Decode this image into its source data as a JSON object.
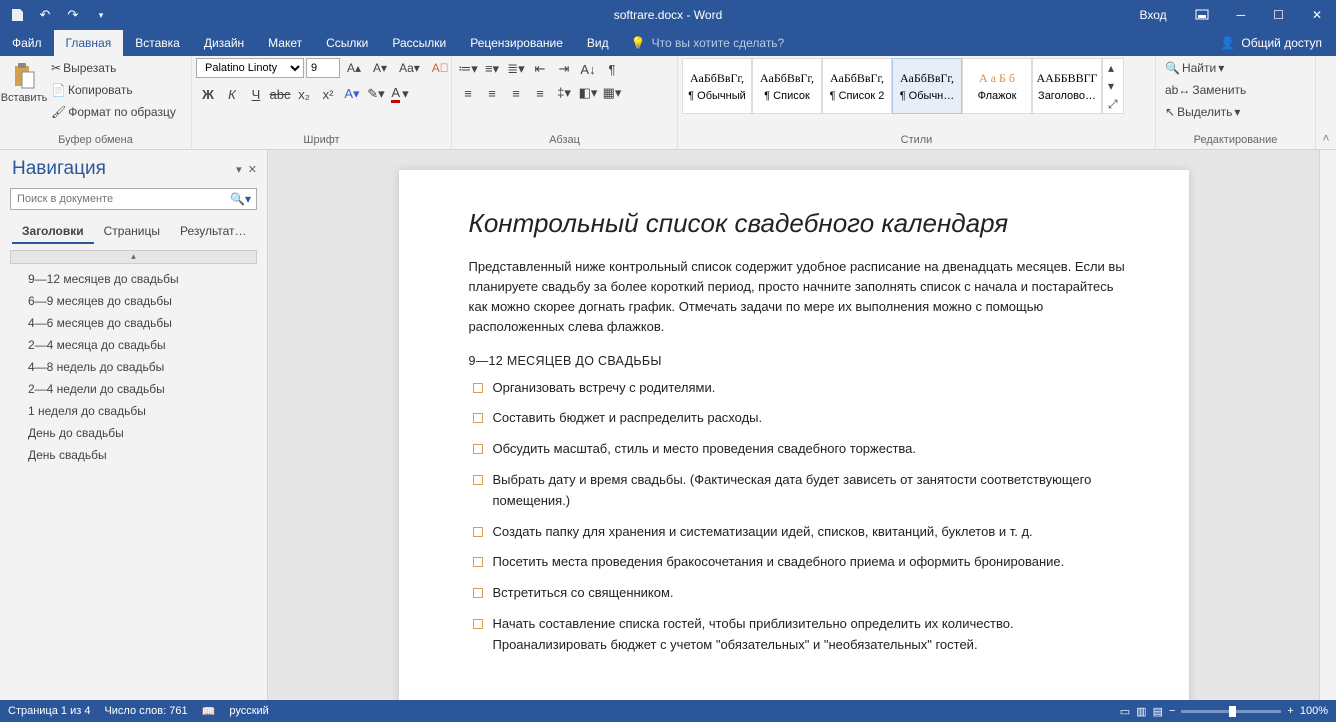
{
  "title": "softrare.docx - Word",
  "title_right": {
    "login": "Вход"
  },
  "menu": [
    "Файл",
    "Главная",
    "Вставка",
    "Дизайн",
    "Макет",
    "Ссылки",
    "Рассылки",
    "Рецензирование",
    "Вид"
  ],
  "tellme": "Что вы хотите сделать?",
  "share": "Общий доступ",
  "ribbon": {
    "clipboard": {
      "label": "Буфер обмена",
      "paste": "Вставить",
      "cut": "Вырезать",
      "copy": "Копировать",
      "format": "Формат по образцу"
    },
    "font": {
      "label": "Шрифт",
      "name": "Palatino Linoty",
      "size": "9"
    },
    "para": {
      "label": "Абзац"
    },
    "styles": {
      "label": "Стили",
      "items": [
        {
          "preview": "АаБбВвГг,",
          "name": "¶ Обычный"
        },
        {
          "preview": "АаБбВвГг,",
          "name": "¶ Список"
        },
        {
          "preview": "АаБбВвГг,",
          "name": "¶ Список 2"
        },
        {
          "preview": "АаБбВвГг,",
          "name": "¶ Обычн…"
        },
        {
          "preview": "А а Б б",
          "name": "Флажок",
          "color": "#e28c3f"
        },
        {
          "preview": "ААББВВГГ",
          "name": "Заголово…"
        }
      ]
    },
    "editing": {
      "label": "Редактирование",
      "find": "Найти",
      "replace": "Заменить",
      "select": "Выделить"
    }
  },
  "nav": {
    "title": "Навигация",
    "search_ph": "Поиск в документе",
    "tabs": [
      "Заголовки",
      "Страницы",
      "Результат…"
    ],
    "items": [
      "9—12 месяцев до свадьбы",
      "6—9 месяцев до свадьбы",
      "4—6 месяцев до свадьбы",
      "2—4 месяца до свадьбы",
      "4—8 недель до свадьбы",
      "2—4 недели до свадьбы",
      "1 неделя до свадьбы",
      "День до свадьбы",
      "День свадьбы"
    ]
  },
  "doc": {
    "h1": "Контрольный список свадебного календаря",
    "intro": "Представленный ниже контрольный список содержит удобное расписание на двенадцать месяцев. Если вы планируете свадьбу за более короткий период, просто начните заполнять список с начала и постарайтесь как можно скорее догнать график. Отмечать задачи по мере их выполнения можно с помощью расположенных слева флажков.",
    "h2": "9—12 МЕСЯЦЕВ ДО СВАДЬБЫ",
    "items": [
      "Организовать встречу с родителями.",
      "Составить бюджет и распределить расходы.",
      "Обсудить масштаб, стиль и место проведения свадебного торжества.",
      "Выбрать дату и время свадьбы. (Фактическая дата будет зависеть от занятости соответствующего помещения.)",
      "Создать папку для хранения и систематизации идей, списков, квитанций, буклетов и т. д.",
      "Посетить места проведения бракосочетания и свадебного приема и оформить бронирование.",
      "Встретиться со священником.",
      "Начать составление списка гостей, чтобы приблизительно определить их количество. Проанализировать бюджет с учетом \"обязательных\" и \"необязательных\" гостей."
    ]
  },
  "status": {
    "page": "Страница 1 из 4",
    "words": "Число слов: 761",
    "lang": "русский",
    "zoom": "100%"
  }
}
